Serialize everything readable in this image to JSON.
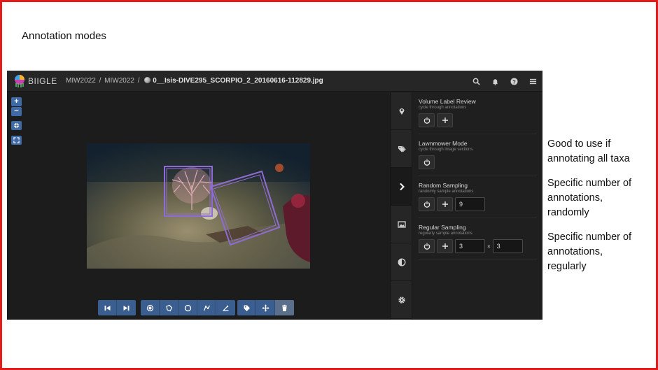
{
  "slide": {
    "title": "Annotation modes",
    "notes": [
      {
        "lines": [
          "Good to use if",
          "annotating all taxa"
        ]
      },
      {
        "lines": [
          "Specific number of",
          "annotations,",
          "randomly"
        ]
      },
      {
        "lines": [
          "Specific number of",
          "annotations,",
          "regularly"
        ]
      }
    ],
    "border_color": "#e21b1b"
  },
  "app": {
    "logo_text": "BIIGLE",
    "breadcrumb": {
      "project": "MIW2022",
      "volume": "MIW2022",
      "filename": "0__Isis-DIVE295_SCORPIO_2_20160616-112829.jpg"
    },
    "top_icons": [
      "search-icon",
      "bell-icon",
      "help-icon",
      "menu-icon"
    ],
    "zoom_controls": {
      "zoom_in": "+",
      "zoom_out": "−"
    },
    "side_tabs": [
      "map-marker-icon",
      "tags-icon",
      "chevron-right-icon",
      "image-icon",
      "contrast-icon",
      "gear-icon"
    ],
    "annotation_modes": [
      {
        "title": "Volume Label Review",
        "subtitle": "cycle through annotations"
      },
      {
        "title": "Lawnmower Mode",
        "subtitle": "cycle through image sections"
      },
      {
        "title": "Random Sampling",
        "subtitle": "randomly sample annotations",
        "value": "9"
      },
      {
        "title": "Regular Sampling",
        "subtitle": "regularly sample annotations",
        "rows": "3",
        "times": "×",
        "cols": "3"
      }
    ],
    "colors": {
      "accent": "#3f6aa6",
      "annotation": "#8f6bd6",
      "background": "#1f1f1f"
    }
  }
}
